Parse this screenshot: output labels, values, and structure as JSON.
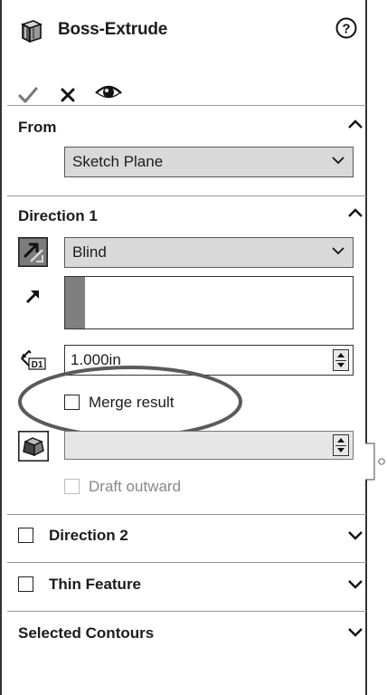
{
  "header": {
    "title": "Boss-Extrude",
    "ok_icon": "checkmark-icon",
    "cancel_icon": "close-icon",
    "preview_icon": "eye-icon",
    "help_icon": "help-icon"
  },
  "from": {
    "heading": "From",
    "start_condition": "Sketch Plane"
  },
  "direction1": {
    "heading": "Direction 1",
    "end_condition": "Blind",
    "depth": "1.000in",
    "merge_label": "Merge result",
    "merge_checked": false,
    "draft_label": "Draft outward",
    "draft_checked": false,
    "draft_angle": ""
  },
  "direction2": {
    "label": "Direction 2",
    "checked": false
  },
  "thin_feature": {
    "label": "Thin Feature",
    "checked": false
  },
  "selected_contours": {
    "label": "Selected Contours"
  }
}
